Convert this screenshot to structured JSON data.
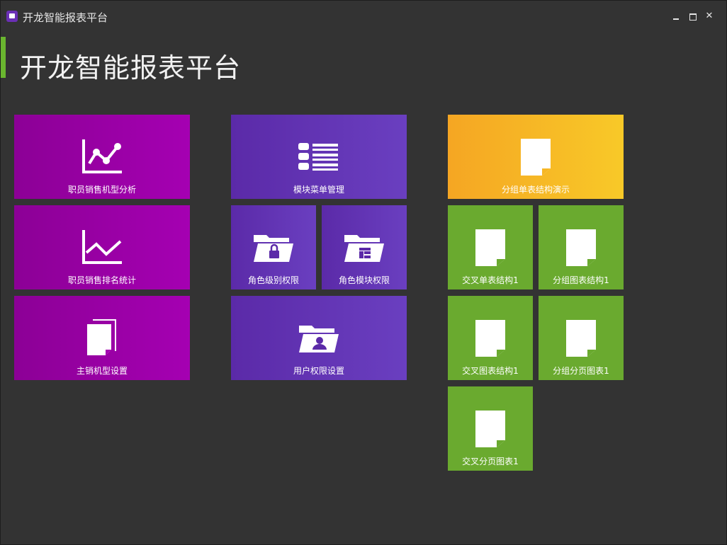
{
  "window": {
    "title": "开龙智能报表平台"
  },
  "header": {
    "title": "开龙智能报表平台"
  },
  "colors": {
    "accent": "#6ab62f",
    "purple": "#9c00aa",
    "violet": "#5e34b0",
    "orange": "#f7b725",
    "green": "#6aaa2f"
  },
  "tiles": {
    "t1": {
      "label": "职员销售机型分析",
      "icon": "line-chart-dots-icon"
    },
    "t2": {
      "label": "职员销售排名统计",
      "icon": "line-chart-icon"
    },
    "t3": {
      "label": "主销机型设置",
      "icon": "documents-icon"
    },
    "t4": {
      "label": "模块菜单管理",
      "icon": "list-icon"
    },
    "t5": {
      "label": "角色级别权限",
      "icon": "folder-lock-icon"
    },
    "t6": {
      "label": "角色模块权限",
      "icon": "folder-layout-icon"
    },
    "t7": {
      "label": "用户权限设置",
      "icon": "folder-user-icon"
    },
    "t8": {
      "label": "分组单表结构演示",
      "icon": "document-icon"
    },
    "t9": {
      "label": "交叉单表结构1",
      "icon": "document-icon"
    },
    "t10": {
      "label": "分组图表结构1",
      "icon": "document-icon"
    },
    "t11": {
      "label": "交叉图表结构1",
      "icon": "document-icon"
    },
    "t12": {
      "label": "分组分页图表1",
      "icon": "document-icon"
    },
    "t13": {
      "label": "交叉分页图表1",
      "icon": "document-icon"
    }
  }
}
